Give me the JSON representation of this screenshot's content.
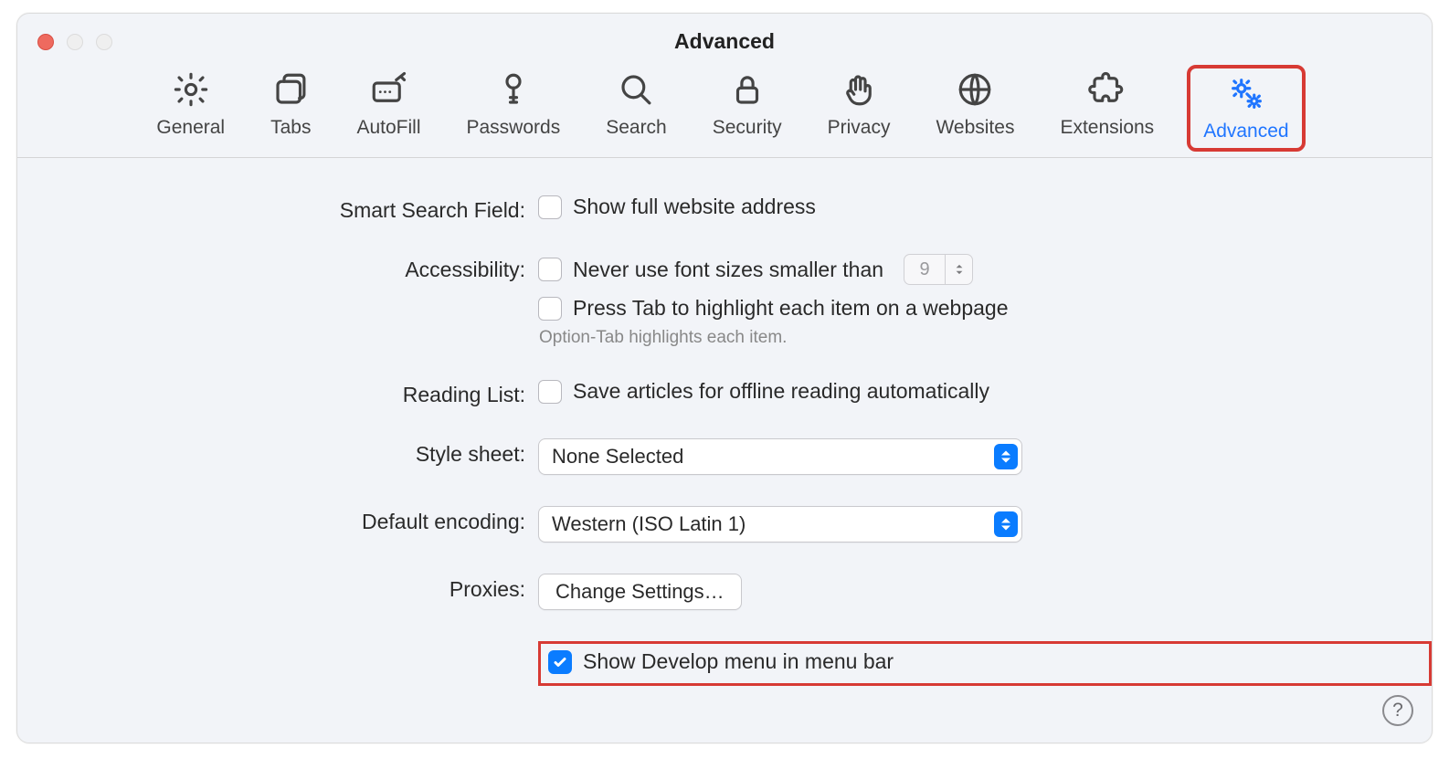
{
  "window": {
    "title": "Advanced"
  },
  "tabs": [
    {
      "id": "general",
      "label": "General"
    },
    {
      "id": "tabs",
      "label": "Tabs"
    },
    {
      "id": "autofill",
      "label": "AutoFill"
    },
    {
      "id": "passwords",
      "label": "Passwords"
    },
    {
      "id": "search",
      "label": "Search"
    },
    {
      "id": "security",
      "label": "Security"
    },
    {
      "id": "privacy",
      "label": "Privacy"
    },
    {
      "id": "websites",
      "label": "Websites"
    },
    {
      "id": "extensions",
      "label": "Extensions"
    },
    {
      "id": "advanced",
      "label": "Advanced",
      "active": true
    }
  ],
  "smartSearch": {
    "label": "Smart Search Field:",
    "showFull": {
      "label": "Show full website address",
      "checked": false
    }
  },
  "accessibility": {
    "label": "Accessibility:",
    "minFont": {
      "label": "Never use font sizes smaller than",
      "checked": false,
      "value": "9"
    },
    "tabHL": {
      "label": "Press Tab to highlight each item on a webpage",
      "checked": false
    },
    "hint": "Option-Tab highlights each item."
  },
  "readingList": {
    "label": "Reading List:",
    "offline": {
      "label": "Save articles for offline reading automatically",
      "checked": false
    }
  },
  "stylesheet": {
    "label": "Style sheet:",
    "value": "None Selected"
  },
  "encoding": {
    "label": "Default encoding:",
    "value": "Western (ISO Latin 1)"
  },
  "proxies": {
    "label": "Proxies:",
    "button": "Change Settings…"
  },
  "develop": {
    "label": "Show Develop menu in menu bar",
    "checked": true
  },
  "help": "?"
}
